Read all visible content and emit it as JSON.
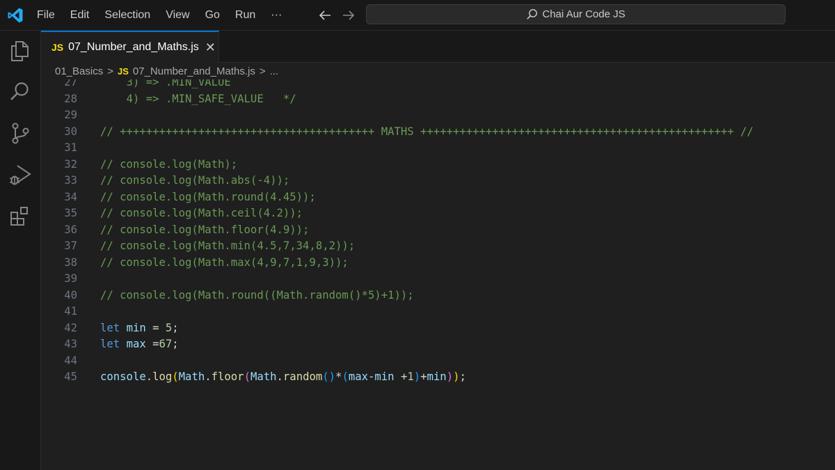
{
  "menu": {
    "items": [
      "File",
      "Edit",
      "Selection",
      "View",
      "Go",
      "Run",
      "···"
    ]
  },
  "search": {
    "label": "Chai Aur Code JS"
  },
  "tab": {
    "badge": "JS",
    "label": "07_Number_and_Maths.js",
    "close": "✕"
  },
  "breadcrumb": {
    "folder": "01_Basics",
    "sep": ">",
    "badge": "JS",
    "file": "07_Number_and_Maths.js",
    "ellipsis": "..."
  },
  "colors": {
    "accent": "#0078d4",
    "js_badge": "#f5de19",
    "comment": "#6a9955",
    "keyword": "#569cd6",
    "variable": "#9cdcfe",
    "function": "#dcdcaa",
    "number": "#b5cea8"
  },
  "activity_icons": [
    "explorer-icon",
    "search-icon",
    "source-control-icon",
    "run-debug-icon",
    "extensions-icon"
  ],
  "editor": {
    "lines": [
      {
        "n": "27",
        "tokens": [
          {
            "t": "    3) => .MIN_VALUE",
            "c": "comment"
          }
        ]
      },
      {
        "n": "28",
        "tokens": [
          {
            "t": "    4) => .MIN_SAFE_VALUE   */",
            "c": "comment"
          }
        ]
      },
      {
        "n": "29",
        "tokens": []
      },
      {
        "n": "30",
        "tokens": [
          {
            "t": "// +++++++++++++++++++++++++++++++++++++++ MATHS ++++++++++++++++++++++++++++++++++++++++++++++++ //",
            "c": "comment"
          }
        ]
      },
      {
        "n": "31",
        "tokens": []
      },
      {
        "n": "32",
        "tokens": [
          {
            "t": "// console.log(Math);",
            "c": "comment"
          }
        ]
      },
      {
        "n": "33",
        "tokens": [
          {
            "t": "// console.log(Math.abs(-4));",
            "c": "comment"
          }
        ]
      },
      {
        "n": "34",
        "tokens": [
          {
            "t": "// console.log(Math.round(4.45));",
            "c": "comment"
          }
        ]
      },
      {
        "n": "35",
        "tokens": [
          {
            "t": "// console.log(Math.ceil(4.2));",
            "c": "comment"
          }
        ]
      },
      {
        "n": "36",
        "tokens": [
          {
            "t": "// console.log(Math.floor(4.9));",
            "c": "comment"
          }
        ]
      },
      {
        "n": "37",
        "tokens": [
          {
            "t": "// console.log(Math.min(4.5,7,34,8,2));",
            "c": "comment"
          }
        ]
      },
      {
        "n": "38",
        "tokens": [
          {
            "t": "// console.log(Math.max(4,9,7,1,9,3));",
            "c": "comment"
          }
        ]
      },
      {
        "n": "39",
        "tokens": []
      },
      {
        "n": "40",
        "tokens": [
          {
            "t": "// console.log(Math.round((Math.random()*5)+1));",
            "c": "comment"
          }
        ]
      },
      {
        "n": "41",
        "tokens": []
      },
      {
        "n": "42",
        "tokens": [
          {
            "t": "let",
            "c": "kw"
          },
          {
            "t": " ",
            "c": "op"
          },
          {
            "t": "min",
            "c": "var"
          },
          {
            "t": " = ",
            "c": "op"
          },
          {
            "t": "5",
            "c": "num"
          },
          {
            "t": ";",
            "c": "op"
          }
        ]
      },
      {
        "n": "43",
        "tokens": [
          {
            "t": "let",
            "c": "kw"
          },
          {
            "t": " ",
            "c": "op"
          },
          {
            "t": "max",
            "c": "var"
          },
          {
            "t": " =",
            "c": "op"
          },
          {
            "t": "67",
            "c": "num"
          },
          {
            "t": ";",
            "c": "op"
          }
        ]
      },
      {
        "n": "44",
        "tokens": []
      },
      {
        "n": "45",
        "tokens": [
          {
            "t": "console",
            "c": "var"
          },
          {
            "t": ".",
            "c": "op"
          },
          {
            "t": "log",
            "c": "fn"
          },
          {
            "t": "(",
            "c": "b1"
          },
          {
            "t": "Math",
            "c": "var"
          },
          {
            "t": ".",
            "c": "op"
          },
          {
            "t": "floor",
            "c": "fn"
          },
          {
            "t": "(",
            "c": "b2"
          },
          {
            "t": "Math",
            "c": "var"
          },
          {
            "t": ".",
            "c": "op"
          },
          {
            "t": "random",
            "c": "fn"
          },
          {
            "t": "()",
            "c": "b3"
          },
          {
            "t": "*",
            "c": "op"
          },
          {
            "t": "(",
            "c": "b3"
          },
          {
            "t": "max",
            "c": "var"
          },
          {
            "t": "-",
            "c": "op"
          },
          {
            "t": "min",
            "c": "var"
          },
          {
            "t": " +",
            "c": "op"
          },
          {
            "t": "1",
            "c": "num"
          },
          {
            "t": ")",
            "c": "b3"
          },
          {
            "t": "+",
            "c": "op"
          },
          {
            "t": "min",
            "c": "var"
          },
          {
            "t": ")",
            "c": "b2"
          },
          {
            "t": ")",
            "c": "b1"
          },
          {
            "t": ";",
            "c": "op"
          }
        ]
      }
    ]
  }
}
